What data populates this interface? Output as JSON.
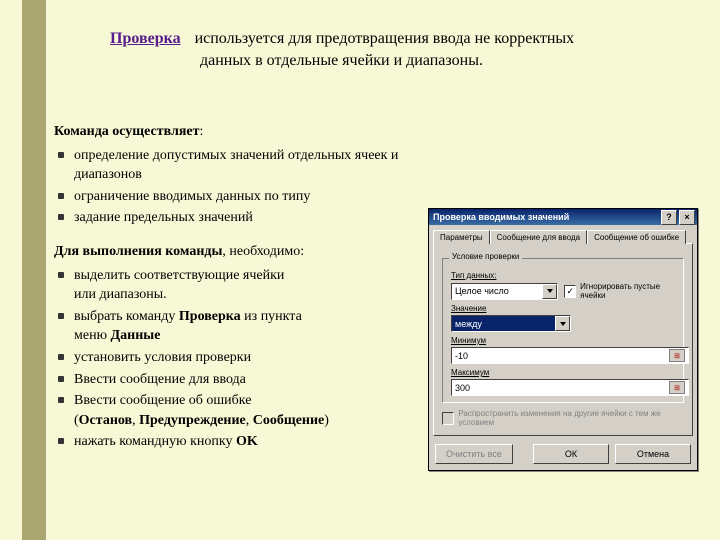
{
  "header": {
    "title": "Проверка",
    "desc_line1": "используется для предотвращения ввода не корректных",
    "desc_line2": "данных в отдельные ячейки и диапазоны."
  },
  "section1": {
    "lead": "Команда осуществляет",
    "colon": ":",
    "items": [
      " определение допустимых значений отдельных ячеек и  диапазонов",
      "ограничение вводимых данных по типу",
      "задание предельных значений"
    ]
  },
  "section2": {
    "lead": "Для выполнения команды",
    "tail": ", необходимо:",
    "i1a": "выделить соответствующие ячейки",
    "i1b": "или диапазоны.",
    "i2a": "выбрать команду ",
    "i2b": "Проверка",
    "i2c": " из пункта",
    "i2d": "меню ",
    "i2e": "Данные",
    "i3": "установить условия проверки",
    "i4": "Ввести сообщение для ввода",
    "i5": "Ввести сообщение об ошибке",
    "i6a": "(",
    "i6b": "Останов",
    "i6c": ", ",
    "i6d": "Предупреждение",
    "i6e": ", ",
    "i6f": "Cообщение",
    "i6g": ")",
    "i7a": "нажать командную кнопку ",
    "i7b": "OK"
  },
  "dialog": {
    "title": "Проверка вводимых значений",
    "help": "?",
    "close": "×",
    "tabs": [
      "Параметры",
      "Сообщение для ввода",
      "Сообщение об ошибке"
    ],
    "group_caption": "Условие проверки",
    "type_label": "Тип данных:",
    "type_value": "Целое число",
    "ignore_label": "Игнорировать пустые ячейки",
    "cond_label": "Значение",
    "cond_value": "между",
    "min_label": "Минимум",
    "min_value": "-10",
    "max_label": "Максимум",
    "max_value": "300",
    "spread_label": "Распространить изменения на другие ячейки с тем же условием",
    "clear": "Очистить все",
    "ok": "ОК",
    "cancel": "Отмена"
  }
}
